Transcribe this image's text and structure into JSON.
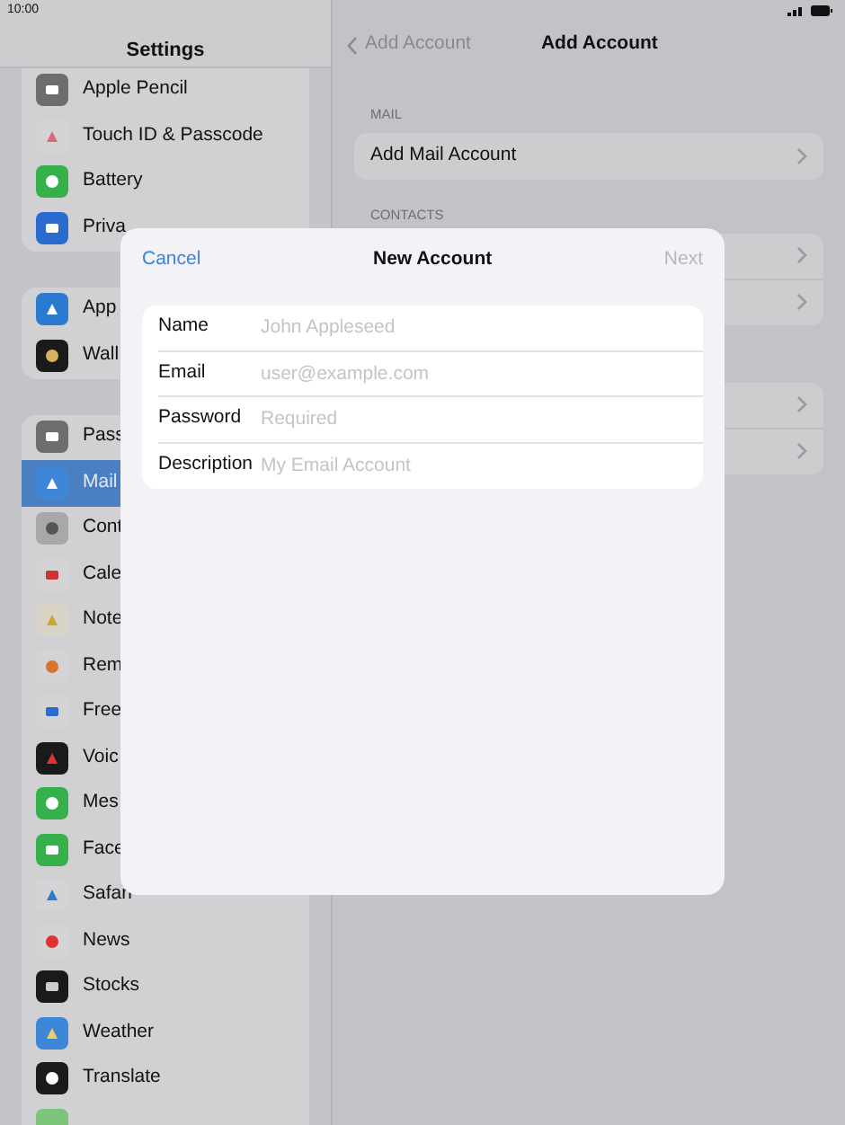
{
  "status_bar": {
    "time": "10:00"
  },
  "sidebar": {
    "title": "Settings",
    "groups": [
      {
        "items": [
          {
            "label": "Apple Pencil",
            "selected": false
          },
          {
            "label": "Touch ID & Passcode",
            "selected": false
          },
          {
            "label": "Battery",
            "selected": false
          },
          {
            "label": "Priva",
            "selected": false
          }
        ]
      },
      {
        "items": [
          {
            "label": "App",
            "selected": false
          },
          {
            "label": "Wall",
            "selected": false
          }
        ]
      },
      {
        "items": [
          {
            "label": "Pass",
            "selected": false
          },
          {
            "label": "Mail",
            "selected": true
          },
          {
            "label": "Cont",
            "selected": false
          },
          {
            "label": "Cale",
            "selected": false
          },
          {
            "label": "Note",
            "selected": false
          },
          {
            "label": "Rem",
            "selected": false
          },
          {
            "label": "Free",
            "selected": false
          },
          {
            "label": "Voic",
            "selected": false
          },
          {
            "label": "Mes",
            "selected": false
          },
          {
            "label": "Face",
            "selected": false
          },
          {
            "label": "Safari",
            "selected": false
          },
          {
            "label": "News",
            "selected": false
          },
          {
            "label": "Stocks",
            "selected": false
          },
          {
            "label": "Weather",
            "selected": false
          },
          {
            "label": "Translate",
            "selected": false
          }
        ]
      }
    ]
  },
  "detail": {
    "back": "Add Account",
    "title": "Add Account",
    "sections": [
      {
        "header": "MAIL",
        "rows": [
          "Add Mail Account"
        ]
      },
      {
        "header": "CONTACTS"
      }
    ]
  },
  "dialog": {
    "cancel": "Cancel",
    "title": "New Account",
    "next": "Next",
    "next_disabled": true,
    "fields": [
      {
        "label": "Name",
        "placeholder": "John Appleseed"
      },
      {
        "label": "Email",
        "placeholder": "user@example.com"
      },
      {
        "label": "Password",
        "placeholder": "Required"
      },
      {
        "label": "Description",
        "placeholder": "My Email Account"
      }
    ]
  }
}
